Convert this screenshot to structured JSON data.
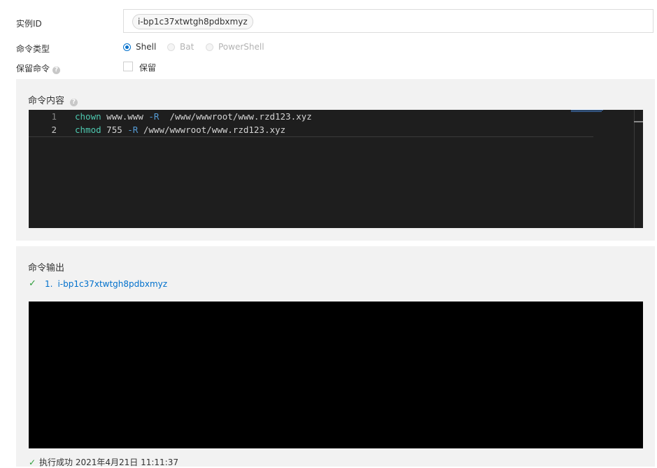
{
  "form": {
    "instance_id_label": "实例ID",
    "instance_id_tag": "i-bp1c37xtwtgh8pdbxmyz",
    "command_type_label": "命令类型",
    "command_types": [
      {
        "label": "Shell",
        "selected": true,
        "disabled": false
      },
      {
        "label": "Bat",
        "selected": false,
        "disabled": true
      },
      {
        "label": "PowerShell",
        "selected": false,
        "disabled": true
      }
    ],
    "keep_command_label": "保留命令",
    "keep_checkbox_label": "保留",
    "keep_checked": false
  },
  "command_content": {
    "title": "命令内容",
    "lines": [
      {
        "number": "1",
        "cmd": "chown",
        "arg1": " www.www ",
        "flag": "-R",
        "arg2": "  /www/wwwroot/www.rzd123.xyz"
      },
      {
        "number": "2",
        "cmd": "chmod",
        "arg1": " 755 ",
        "flag": "-R",
        "arg2": " /www/wwwroot/www.rzd123.xyz"
      }
    ]
  },
  "command_output": {
    "title": "命令输出",
    "item_index": "1.",
    "item_instance": "i-bp1c37xtwtgh8pdbxmyz",
    "status_text": "执行成功 2021年4月21日 11:11:37"
  },
  "colors": {
    "accent": "#0070cc",
    "success": "#2e9d3a",
    "editor_bg": "#1e1e1e",
    "terminal_bg": "#000000"
  },
  "icons": {
    "help": "help-icon",
    "success": "check-icon"
  }
}
